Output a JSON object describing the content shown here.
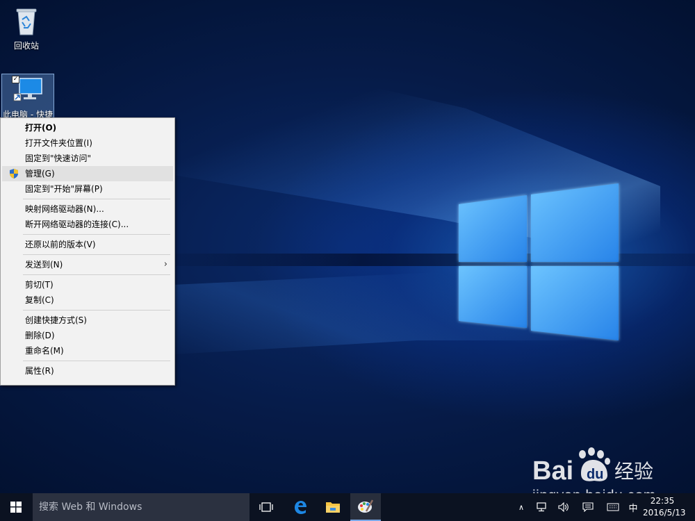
{
  "desktop": {
    "icons": [
      {
        "label": "回收站"
      },
      {
        "label": "此电脑 - 快捷"
      }
    ]
  },
  "context_menu": {
    "items": [
      {
        "label": "打开(O)"
      },
      {
        "label": "打开文件夹位置(I)"
      },
      {
        "label": "固定到\"快速访问\""
      },
      {
        "label": "管理(G)"
      },
      {
        "label": "固定到\"开始\"屏幕(P)"
      },
      {
        "label": "映射网络驱动器(N)..."
      },
      {
        "label": "断开网络驱动器的连接(C)..."
      },
      {
        "label": "还原以前的版本(V)"
      },
      {
        "label": "发送到(N)"
      },
      {
        "label": "剪切(T)"
      },
      {
        "label": "复制(C)"
      },
      {
        "label": "创建快捷方式(S)"
      },
      {
        "label": "删除(D)"
      },
      {
        "label": "重命名(M)"
      },
      {
        "label": "属性(R)"
      }
    ]
  },
  "taskbar": {
    "search_placeholder": "搜索 Web 和 Windows",
    "tray": {
      "ime": "中",
      "time": "22:35",
      "date": "2016/5/13"
    }
  },
  "watermark": {
    "brand": "Bai",
    "brand_suffix": "经验",
    "url": "jingyan.baidu.com"
  }
}
